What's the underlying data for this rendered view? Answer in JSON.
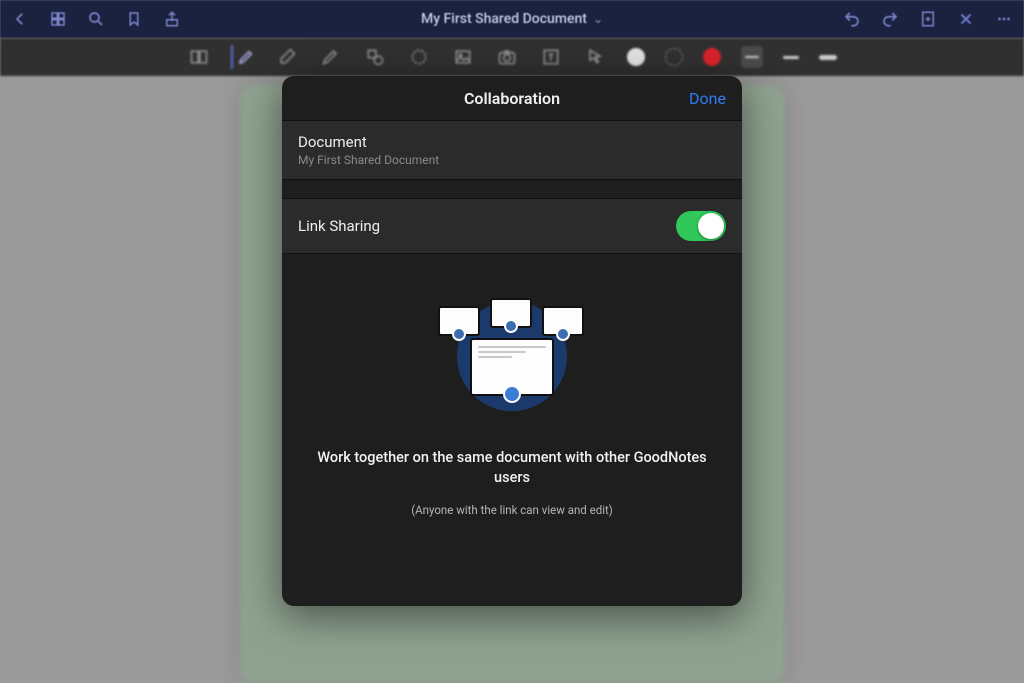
{
  "navbar": {
    "title": "My First Shared Document",
    "chevron": "⌄"
  },
  "modal": {
    "header": "Collaboration",
    "done": "Done",
    "document_label": "Document",
    "document_name": "My First Shared Document",
    "link_sharing_label": "Link Sharing",
    "link_sharing_enabled": true,
    "illustration_title": "Work together on the same document with other GoodNotes users",
    "illustration_subtitle": "(Anyone with the link can view and edit)"
  },
  "colors": {
    "accent": "#2e7cf6",
    "toggle_on": "#30c85a",
    "navbar_bg": "#1a2240",
    "toolbar_bg": "#303030",
    "modal_bg": "#1e1e1e"
  }
}
